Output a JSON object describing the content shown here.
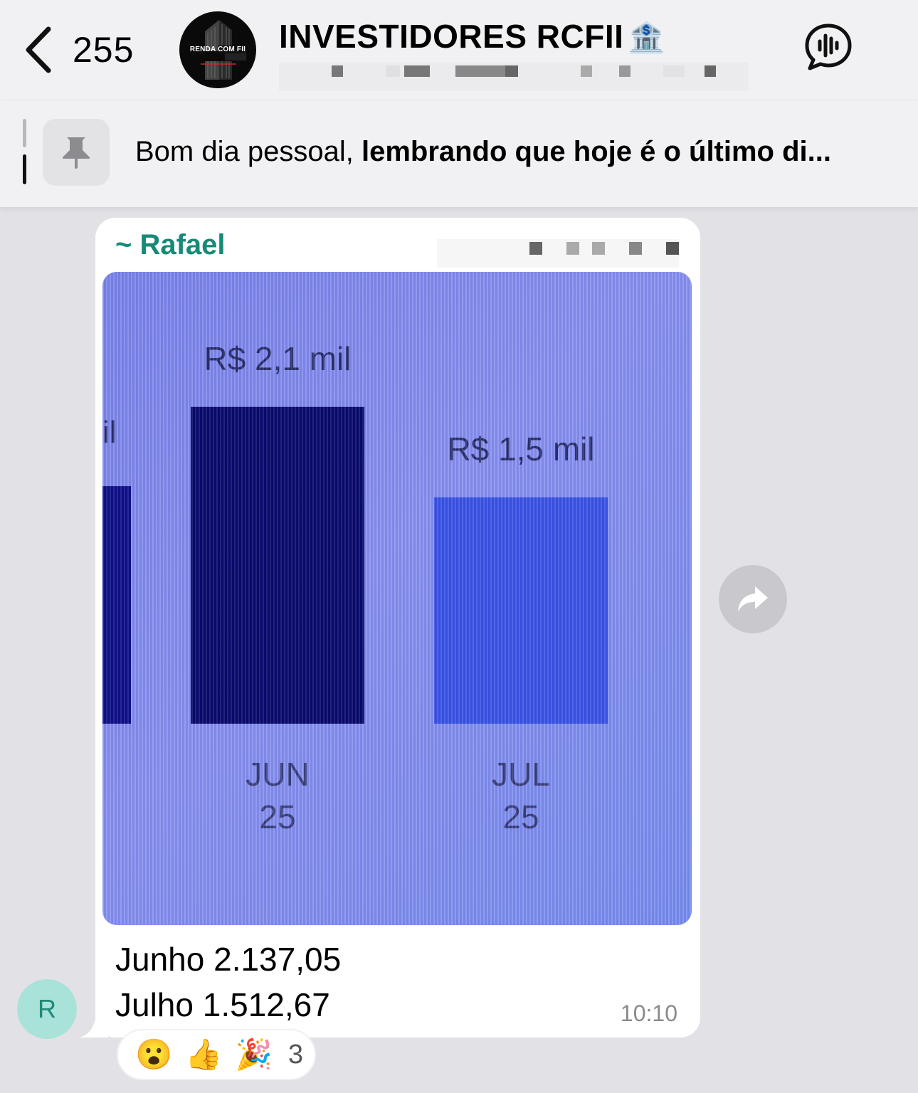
{
  "header": {
    "back_count": "255",
    "group_title": "INVESTIDORES RCFII",
    "title_emoji": "🏦",
    "avatar_label_a": "RENDA",
    "avatar_label_b": "COM FII"
  },
  "pinned": {
    "text_regular": "Bom dia pessoal, ",
    "text_bold": "lembrando que hoje é o último di..."
  },
  "message": {
    "sender": "~ Rafael",
    "caption_line1": "Junho 2.137,05",
    "caption_line2": "Julho 1.512,67",
    "time": "10:10",
    "avatar_initial": "R"
  },
  "reactions": {
    "emojis": [
      "😮",
      "👍",
      "🎉"
    ],
    "count": "3"
  },
  "chart_data": {
    "type": "bar",
    "categories": [
      "JUN 25",
      "JUL 25"
    ],
    "values": [
      2.1,
      1.5
    ],
    "data_labels": [
      "R$ 2,1 mil",
      "R$ 1,5 mil"
    ],
    "partial_left_label": "il",
    "cat_line1": [
      "JUN",
      "JUL"
    ],
    "cat_line2": [
      "25",
      "25"
    ],
    "colors": [
      "#0a0a6e",
      "#3b55e8"
    ],
    "partial_bar_color": "#10108a"
  },
  "colors": {
    "sender_name": "#178a77",
    "avatar_bg": "#a9e2d8"
  }
}
